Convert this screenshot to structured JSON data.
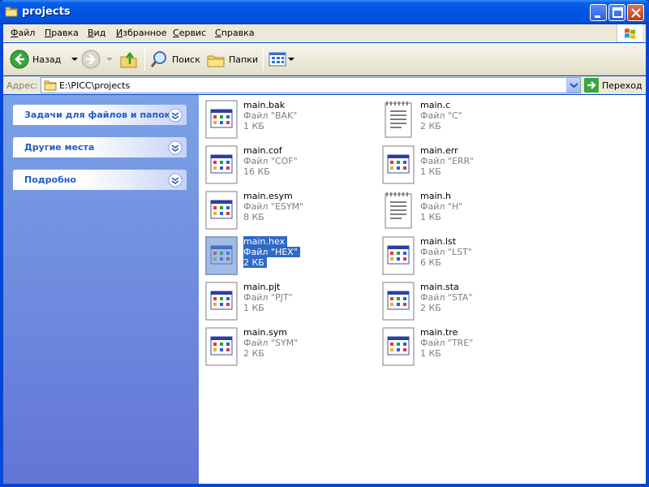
{
  "window": {
    "title": "projects"
  },
  "menu": {
    "items": [
      "Файл",
      "Правка",
      "Вид",
      "Избранное",
      "Сервис",
      "Справка"
    ]
  },
  "toolbar": {
    "back_label": "Назад",
    "search_label": "Поиск",
    "folders_label": "Папки"
  },
  "address": {
    "label": "Адрес:",
    "value": "E:\\PICC\\projects",
    "go_label": "Переход"
  },
  "tasks": {
    "panels": [
      "Задачи для файлов и папок",
      "Другие места",
      "Подробно"
    ]
  },
  "files": [
    {
      "name": "main.bak",
      "type": "Файл \"BAK\"",
      "size": "1 КБ",
      "icon": "generic-app-icon"
    },
    {
      "name": "main.c",
      "type": "Файл \"C\"",
      "size": "2 КБ",
      "icon": "text-document-icon"
    },
    {
      "name": "main.cof",
      "type": "Файл \"COF\"",
      "size": "16 КБ",
      "icon": "generic-app-icon"
    },
    {
      "name": "main.err",
      "type": "Файл \"ERR\"",
      "size": "1 КБ",
      "icon": "generic-app-icon"
    },
    {
      "name": "main.esym",
      "type": "Файл \"ESYM\"",
      "size": "8 КБ",
      "icon": "generic-app-icon"
    },
    {
      "name": "main.h",
      "type": "Файл \"H\"",
      "size": "1 КБ",
      "icon": "text-document-icon"
    },
    {
      "name": "main.hex",
      "type": "Файл \"HEX\"",
      "size": "2 КБ",
      "icon": "generic-app-icon",
      "selected": true
    },
    {
      "name": "main.lst",
      "type": "Файл \"LST\"",
      "size": "6 КБ",
      "icon": "generic-app-icon"
    },
    {
      "name": "main.pjt",
      "type": "Файл \"PJT\"",
      "size": "1 КБ",
      "icon": "generic-app-icon"
    },
    {
      "name": "main.sta",
      "type": "Файл \"STA\"",
      "size": "2 КБ",
      "icon": "generic-app-icon"
    },
    {
      "name": "main.sym",
      "type": "Файл \"SYM\"",
      "size": "2 КБ",
      "icon": "generic-app-icon"
    },
    {
      "name": "main.tre",
      "type": "Файл \"TRE\"",
      "size": "1 КБ",
      "icon": "generic-app-icon"
    }
  ],
  "colors": {
    "titlebar": "#0054e3",
    "selection": "#316ac5",
    "task_link": "#215dc6"
  }
}
